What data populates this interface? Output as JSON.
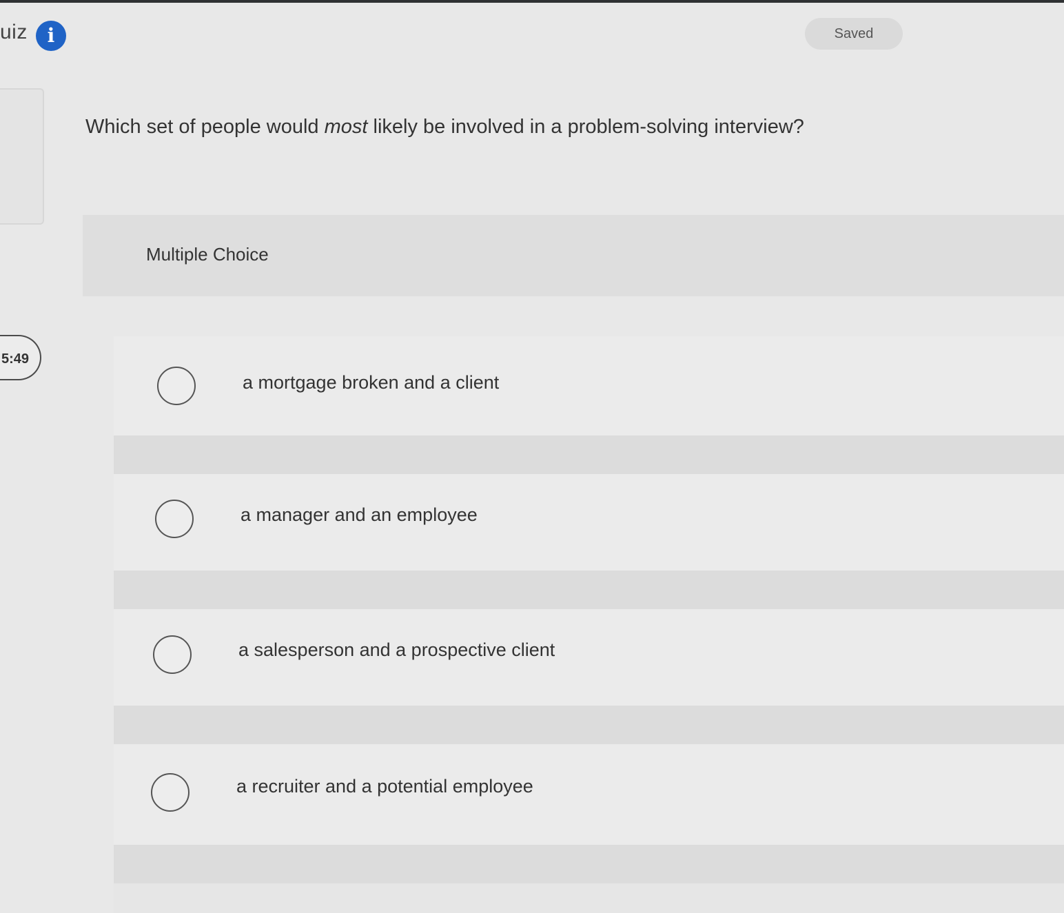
{
  "header": {
    "title": "uiz",
    "info_icon": "info-icon",
    "saved_label": "Saved"
  },
  "timer": {
    "text": "5:49"
  },
  "question": {
    "text_before": "Which set of people would ",
    "emphasis": "most",
    "text_after": " likely be involved in a problem-solving interview?"
  },
  "answer_section": {
    "type_label": "Multiple Choice",
    "choices": [
      {
        "label": "a mortgage broken and a client",
        "selected": false
      },
      {
        "label": "a manager and an employee",
        "selected": false
      },
      {
        "label": "a salesperson and a prospective client",
        "selected": false
      },
      {
        "label": "a recruiter and a potential employee",
        "selected": false
      }
    ]
  },
  "colors": {
    "info_icon": "#1f63c6",
    "page_background": "#e8e8e8",
    "text": "#333333"
  }
}
